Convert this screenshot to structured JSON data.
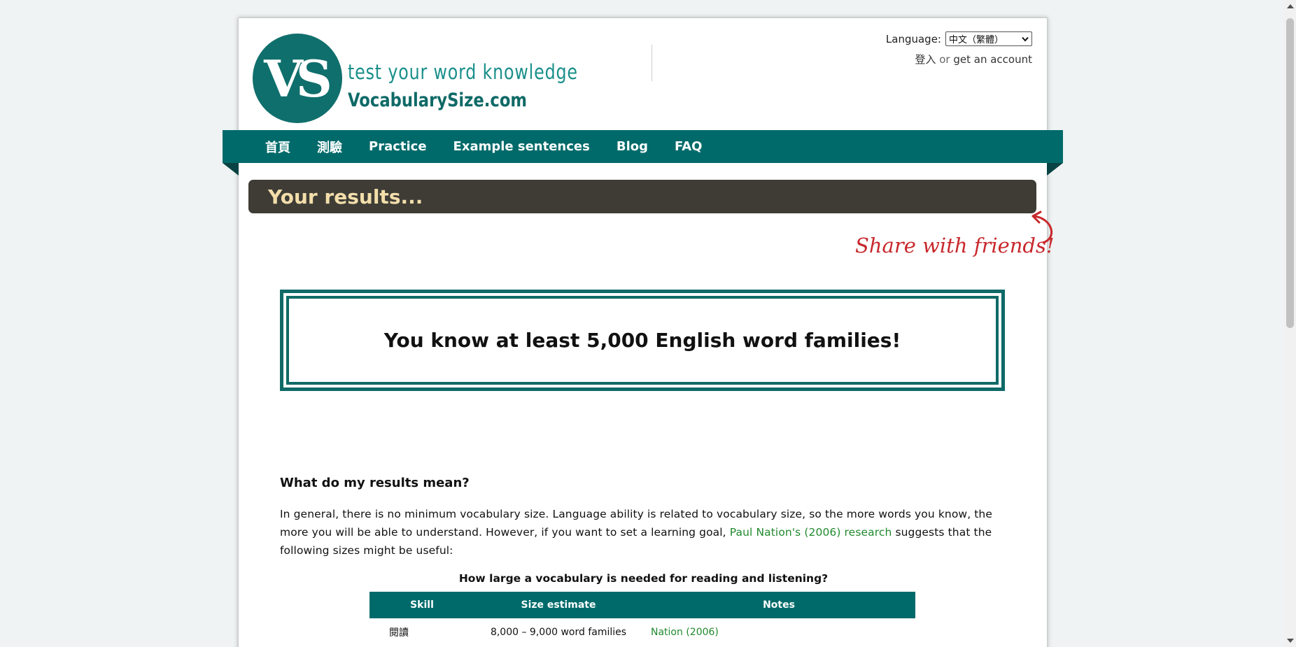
{
  "header": {
    "logo_monogram": "VS",
    "logo_tagline": "test your word knowledge",
    "logo_domain": "VocabularySize.com",
    "language_label": "Language:",
    "language_selected": "中文（繁體）",
    "login_label": "登入",
    "or_text": "or",
    "signup_label": "get an account"
  },
  "nav": {
    "items": [
      {
        "label": "首頁"
      },
      {
        "label": "測驗"
      },
      {
        "label": "Practice"
      },
      {
        "label": "Example sentences"
      },
      {
        "label": "Blog"
      },
      {
        "label": "FAQ"
      }
    ]
  },
  "results": {
    "bar_title": "Your results...",
    "share_text": "Share with friends!",
    "headline": "You know at least 5,000 English word families!"
  },
  "content": {
    "heading": "What do my results mean?",
    "para_before_link": "In general, there is no minimum vocabulary size. Language ability is related to vocabulary size, so the more words you know, the more you will be able to understand. However, if you want to set a learning goal, ",
    "para_link": "Paul Nation's (2006) research",
    "para_after_link": " suggests that the following sizes might be useful:",
    "table_caption": "How large a vocabulary is needed for reading and listening?",
    "table": {
      "headers": [
        "Skill",
        "Size estimate",
        "Notes"
      ],
      "rows": [
        {
          "skill": "閱讀",
          "size": "8,000 – 9,000 word families",
          "notes": "Nation (2006)"
        }
      ]
    }
  },
  "colors": {
    "brand_teal": "#006a6a",
    "results_bar": "#3e3c35",
    "results_title": "#f3deab",
    "link_green": "#218a2f",
    "share_red": "#c8282c"
  }
}
